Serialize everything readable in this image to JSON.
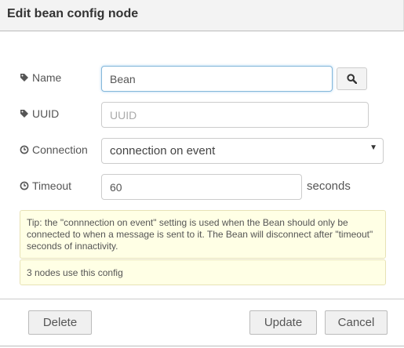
{
  "dialog": {
    "title": "Edit bean config node"
  },
  "form": {
    "name": {
      "label": "Name",
      "icon": "tag-icon",
      "value": "Bean",
      "search_icon": "search-icon"
    },
    "uuid": {
      "label": "UUID",
      "icon": "tag-icon",
      "value": "",
      "placeholder": "UUID"
    },
    "connection": {
      "label": "Connection",
      "icon": "clock-icon",
      "selected": "connection on event"
    },
    "timeout": {
      "label": "Timeout",
      "icon": "clock-icon",
      "value": "60",
      "units": "seconds"
    }
  },
  "tip": {
    "text": "Tip: the \"connnection on event\" setting is used when the Bean should only be connected to when a message is sent to it. The Bean will disconnect after \"timeout\" seconds of innactivity."
  },
  "usage": {
    "text": "3 nodes use this config"
  },
  "buttons": {
    "delete": "Delete",
    "update": "Update",
    "cancel": "Cancel"
  },
  "colors": {
    "title_bar_bg": "#f3f3f3",
    "tip_bg": "#ffffe5",
    "focus_border": "#85b7d9",
    "button_bg": "#f0f0f0"
  }
}
